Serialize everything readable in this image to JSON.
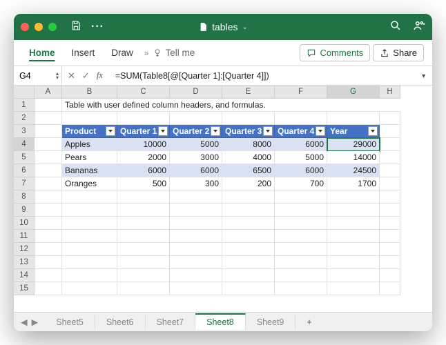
{
  "title": "tables",
  "ribbon": {
    "tabs": [
      "Home",
      "Insert",
      "Draw"
    ],
    "tellme": "Tell me",
    "comments": "Comments",
    "share": "Share"
  },
  "fx": {
    "namebox": "G4",
    "formula": "=SUM(Table8[@[Quarter 1]:[Quarter 4]])"
  },
  "columns": [
    "A",
    "B",
    "C",
    "D",
    "E",
    "F",
    "G",
    "H"
  ],
  "description": "Table with user defined column headers, and formulas.",
  "table": {
    "headers": [
      "Product",
      "Quarter 1",
      "Quarter 2",
      "Quarter 3",
      "Quarter 4",
      "Year"
    ],
    "rows": [
      {
        "product": "Apples",
        "q1": "10000",
        "q2": "5000",
        "q3": "8000",
        "q4": "6000",
        "year": "29000"
      },
      {
        "product": "Pears",
        "q1": "2000",
        "q2": "3000",
        "q3": "4000",
        "q4": "5000",
        "year": "14000"
      },
      {
        "product": "Bananas",
        "q1": "6000",
        "q2": "6000",
        "q3": "6500",
        "q4": "6000",
        "year": "24500"
      },
      {
        "product": "Oranges",
        "q1": "500",
        "q2": "300",
        "q3": "200",
        "q4": "700",
        "year": "1700"
      }
    ]
  },
  "sheets": [
    "Sheet5",
    "Sheet6",
    "Sheet7",
    "Sheet8",
    "Sheet9"
  ],
  "active_sheet": "Sheet8",
  "row_numbers": [
    "1",
    "2",
    "3",
    "4",
    "5",
    "6",
    "7",
    "8",
    "9",
    "10",
    "11",
    "12",
    "13",
    "14",
    "15"
  ]
}
